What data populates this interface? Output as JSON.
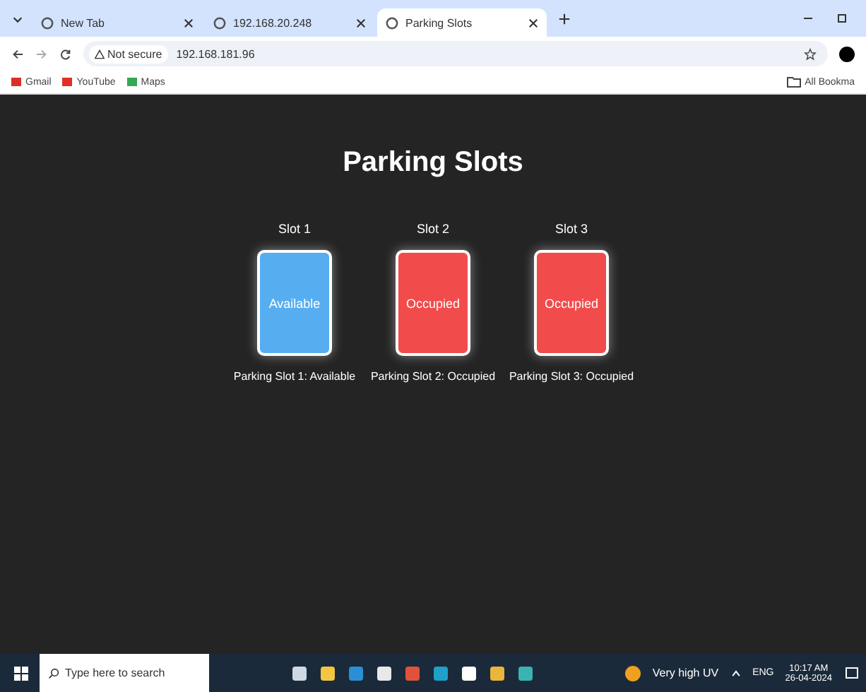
{
  "browser": {
    "tabs": [
      {
        "title": "New Tab",
        "selected": false
      },
      {
        "title": "192.168.20.248",
        "selected": false
      },
      {
        "title": "Parking Slots",
        "selected": true
      }
    ],
    "address": {
      "warning": "Not secure",
      "url": "192.168.181.96"
    },
    "bookmarks": [
      {
        "label": "Gmail"
      },
      {
        "label": "YouTube"
      },
      {
        "label": "Maps"
      }
    ],
    "all_bookmarks": "All Bookma"
  },
  "page": {
    "title": "Parking Slots",
    "slots": [
      {
        "label": "Slot 1",
        "status": "Available",
        "occupied": false,
        "caption": "Parking Slot 1: Available"
      },
      {
        "label": "Slot 2",
        "status": "Occupied",
        "occupied": true,
        "caption": "Parking Slot 2: Occupied"
      },
      {
        "label": "Slot 3",
        "status": "Occupied",
        "occupied": true,
        "caption": "Parking Slot 3: Occupied"
      }
    ]
  },
  "taskbar": {
    "search_placeholder": "Type here to search",
    "weather": "Very high UV",
    "language": "ENG",
    "time": "10:17 AM",
    "date": "26-04-2024"
  }
}
